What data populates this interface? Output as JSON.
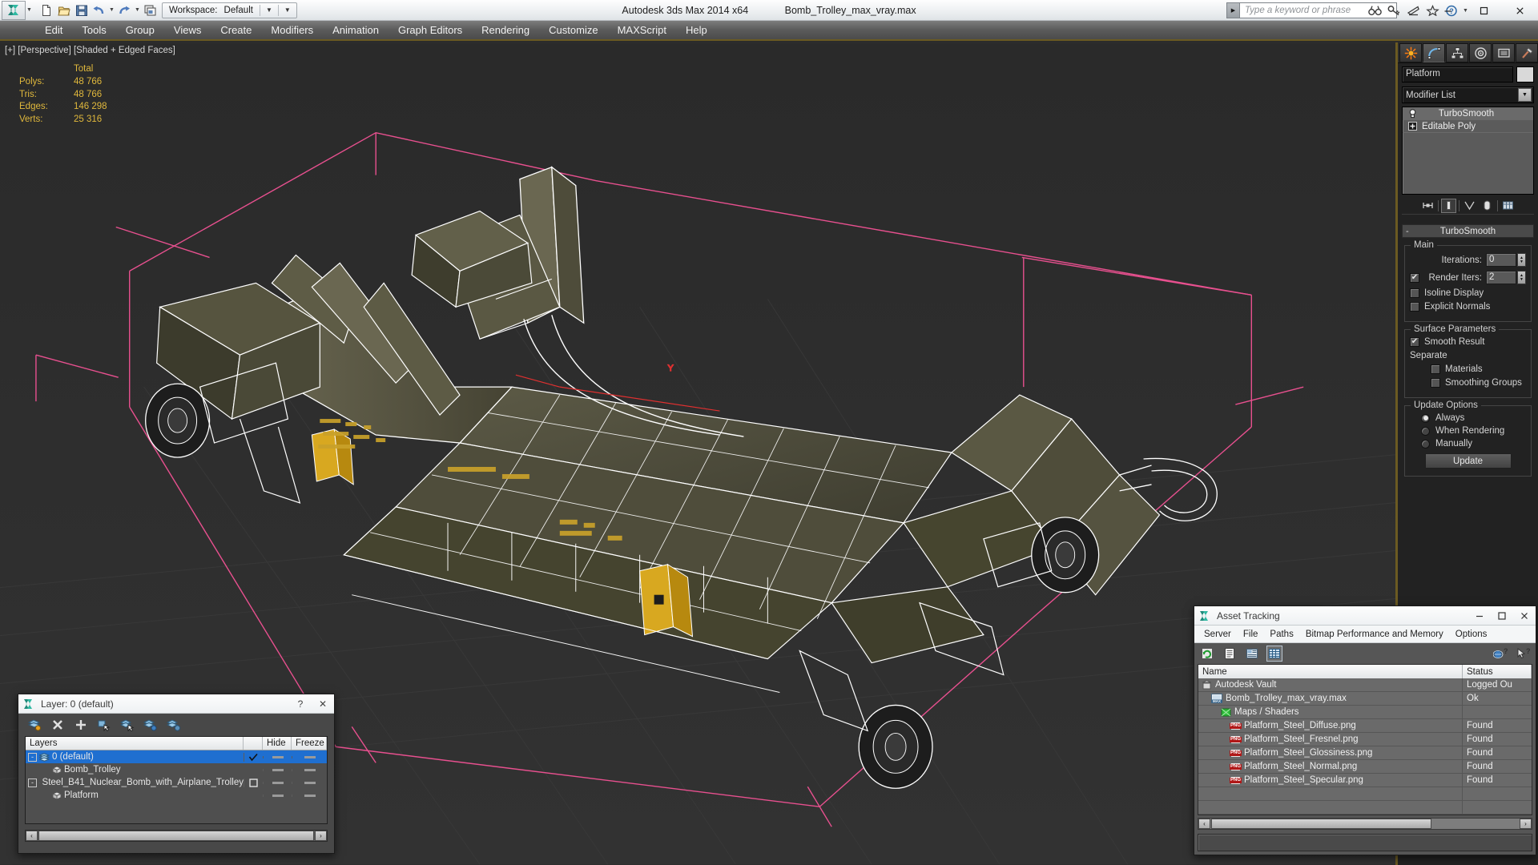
{
  "titlebar": {
    "app_title": "Autodesk 3ds Max  2014 x64",
    "file_name": "Bomb_Trolley_max_vray.max",
    "workspace_label": "Workspace:",
    "workspace_value": "Default",
    "search_placeholder": "Type a keyword or phrase",
    "quick_access": [
      {
        "name": "new-file-icon",
        "title": "New"
      },
      {
        "name": "open-file-icon",
        "title": "Open"
      },
      {
        "name": "save-file-icon",
        "title": "Save"
      },
      {
        "name": "undo-icon",
        "title": "Undo"
      },
      {
        "name": "redo-icon",
        "title": "Redo"
      },
      {
        "name": "project-folder-icon",
        "title": "Set Project Folder"
      }
    ],
    "help_icons": [
      {
        "name": "binoculars-icon",
        "title": "Search"
      },
      {
        "name": "key-icon",
        "title": "Key"
      },
      {
        "name": "satellite-dish-icon",
        "title": "Communication Center"
      },
      {
        "name": "favorites-star-icon",
        "title": "Favorites"
      },
      {
        "name": "help-question-icon",
        "title": "Help"
      }
    ],
    "window_buttons": [
      {
        "name": "minimize-button",
        "glyph": "—"
      },
      {
        "name": "maximize-button",
        "glyph": "☐"
      },
      {
        "name": "close-button",
        "glyph": "✕"
      }
    ]
  },
  "menubar": {
    "items": [
      "Edit",
      "Tools",
      "Group",
      "Views",
      "Create",
      "Modifiers",
      "Animation",
      "Graph Editors",
      "Rendering",
      "Customize",
      "MAXScript",
      "Help"
    ]
  },
  "viewport": {
    "label": "[+] [Perspective] [Shaded + Edged Faces]",
    "stats_header": "Total",
    "stats": [
      {
        "key": "Polys:",
        "value": "48 766"
      },
      {
        "key": "Tris:",
        "value": "48 766"
      },
      {
        "key": "Edges:",
        "value": "146 298"
      },
      {
        "key": "Verts:",
        "value": "25 316"
      }
    ],
    "stats_color": "#e0b83c",
    "background_color": "#2d2d2d",
    "wire_color": "#ffffff",
    "selection_box_color": "#e8508f",
    "gizmo_axis_color": "#e03030"
  },
  "command_panel": {
    "tabs": [
      {
        "name": "create-tab",
        "icon": "create-star-icon",
        "active": false
      },
      {
        "name": "modify-tab",
        "icon": "modify-curve-icon",
        "active": true
      },
      {
        "name": "hierarchy-tab",
        "icon": "hierarchy-icon",
        "active": false
      },
      {
        "name": "motion-tab",
        "icon": "motion-wheel-icon",
        "active": false
      },
      {
        "name": "display-tab",
        "icon": "display-monitor-icon",
        "active": false
      },
      {
        "name": "utilities-tab",
        "icon": "utilities-hammer-icon",
        "active": false
      }
    ],
    "object_name": "Platform",
    "modifier_list_label": "Modifier List",
    "modifier_stack": [
      {
        "label": "TurboSmooth",
        "icon": "lightbulb-icon",
        "selected": true
      },
      {
        "label": "Editable Poly",
        "icon": "plus-expander-icon",
        "selected": false
      }
    ],
    "stack_tools": [
      {
        "name": "pin-stack-icon"
      },
      {
        "name": "show-end-result-icon",
        "boxed": true
      },
      {
        "name": "make-unique-icon"
      },
      {
        "name": "remove-modifier-icon"
      },
      {
        "name": "configure-modifier-sets-icon"
      }
    ],
    "rollout": {
      "title": "TurboSmooth",
      "collapse_glyph": "-",
      "main_group": {
        "title": "Main",
        "iterations_label": "Iterations:",
        "iterations_value": "0",
        "render_iters_label": "Render Iters:",
        "render_iters_value": "2",
        "render_iters_checked": true,
        "isoline_display_label": "Isoline Display",
        "isoline_display_checked": false,
        "explicit_normals_label": "Explicit Normals",
        "explicit_normals_checked": false
      },
      "surface_group": {
        "title": "Surface Parameters",
        "smooth_result_label": "Smooth Result",
        "smooth_result_checked": true,
        "separate_label": "Separate",
        "materials_label": "Materials",
        "materials_checked": false,
        "smoothing_groups_label": "Smoothing Groups",
        "smoothing_groups_checked": false
      },
      "update_group": {
        "title": "Update Options",
        "options": [
          {
            "label": "Always",
            "selected": true
          },
          {
            "label": "When Rendering",
            "selected": false
          },
          {
            "label": "Manually",
            "selected": false
          }
        ],
        "update_button": "Update"
      }
    }
  },
  "layer_dialog": {
    "title": "Layer: 0 (default)",
    "help_glyph": "?",
    "close_glyph": "✕",
    "toolbar": [
      {
        "name": "new-layer-icon"
      },
      {
        "name": "delete-layer-icon"
      },
      {
        "name": "add-to-layer-icon"
      },
      {
        "name": "select-objects-in-layer-icon"
      },
      {
        "name": "select-highlighted-layer-icon"
      },
      {
        "name": "highlight-selected-objects-layer-icon"
      },
      {
        "name": "layer-properties-icon"
      }
    ],
    "columns": [
      "Layers",
      "",
      "Hide",
      "Freeze"
    ],
    "rows": [
      {
        "label": "0 (default)",
        "indent": 0,
        "expander": "-",
        "icon": "layer-icon",
        "selected": true,
        "active_check": true
      },
      {
        "label": "Bomb_Trolley",
        "indent": 1,
        "expander": "",
        "icon": "object-box-icon",
        "selected": false,
        "active_check": false
      },
      {
        "label": "Steel_B41_Nuclear_Bomb_with_Airplane_Trolley",
        "indent": 0,
        "expander": "-",
        "icon": "layer-icon",
        "selected": false,
        "active_check": false,
        "empty_box": true
      },
      {
        "label": "Platform",
        "indent": 1,
        "expander": "",
        "icon": "object-box-icon",
        "selected": false,
        "active_check": false
      }
    ],
    "scroll_left_glyph": "‹",
    "scroll_right_glyph": "›"
  },
  "asset_tracking": {
    "title": "Asset Tracking",
    "window_buttons": [
      {
        "name": "minimize-button",
        "glyph": "—"
      },
      {
        "name": "maximize-button",
        "glyph": "☐"
      },
      {
        "name": "close-button",
        "glyph": "✕"
      }
    ],
    "menu": [
      "Server",
      "File",
      "Paths",
      "Bitmap Performance and Memory",
      "Options"
    ],
    "toolbar": [
      {
        "name": "refresh-icon",
        "selected": false
      },
      {
        "name": "list-view-icon",
        "selected": false
      },
      {
        "name": "details-view-icon",
        "selected": false
      },
      {
        "name": "grid-view-icon",
        "selected": true
      }
    ],
    "toolbar_right": [
      {
        "name": "help-globe-icon"
      },
      {
        "name": "help-arrow-icon"
      }
    ],
    "columns": [
      "Name",
      "Status"
    ],
    "rows": [
      {
        "name": "Autodesk Vault",
        "status": "Logged Ou",
        "indent": 0,
        "icon": "vault-icon"
      },
      {
        "name": "Bomb_Trolley_max_vray.max",
        "status": "Ok",
        "indent": 1,
        "icon": "max-file-icon"
      },
      {
        "name": "Maps / Shaders",
        "status": "",
        "indent": 2,
        "icon": "maps-shaders-icon"
      },
      {
        "name": "Platform_Steel_Diffuse.png",
        "status": "Found",
        "indent": 3,
        "icon": "png-icon"
      },
      {
        "name": "Platform_Steel_Fresnel.png",
        "status": "Found",
        "indent": 3,
        "icon": "png-icon"
      },
      {
        "name": "Platform_Steel_Glossiness.png",
        "status": "Found",
        "indent": 3,
        "icon": "png-icon"
      },
      {
        "name": "Platform_Steel_Normal.png",
        "status": "Found",
        "indent": 3,
        "icon": "png-icon"
      },
      {
        "name": "Platform_Steel_Specular.png",
        "status": "Found",
        "indent": 3,
        "icon": "png-icon"
      },
      {
        "name": "",
        "status": "",
        "indent": 0,
        "icon": ""
      },
      {
        "name": "",
        "status": "",
        "indent": 0,
        "icon": ""
      }
    ],
    "scroll_left_glyph": "‹",
    "scroll_right_glyph": "›"
  }
}
